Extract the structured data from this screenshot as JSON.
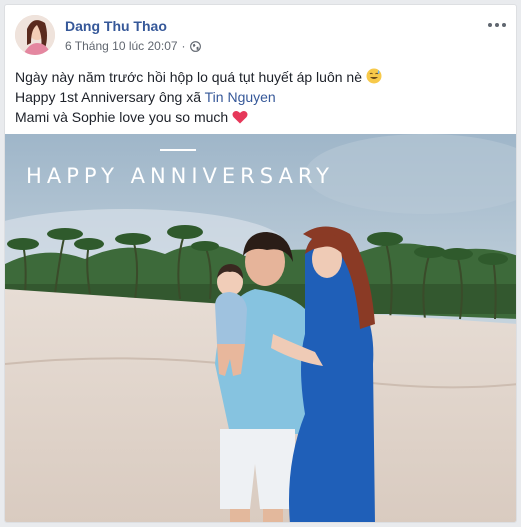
{
  "post": {
    "author": "Dang Thu Thao",
    "timestamp": "6 Tháng 10 lúc 20:07",
    "privacy_icon": "globe-icon",
    "more_icon": "ellipsis-icon",
    "lines": {
      "line1": "Ngày này năm trước hồi hộp lo quá tụt huyết áp luôn nè",
      "line2_prefix": "Happy 1st Anniversary ông xã",
      "line2_tag": "Tin Nguyen",
      "line3": "Mami và Sophie love you so much"
    },
    "emojis": {
      "line1": "grinning-sweat-emoji",
      "line3": "red-heart-emoji"
    },
    "photo_overlay_text": "HAPPY ANNIVERSARY"
  },
  "colors": {
    "link": "#365899",
    "heart": "#e6385a",
    "dress": "#1f5fb8"
  }
}
